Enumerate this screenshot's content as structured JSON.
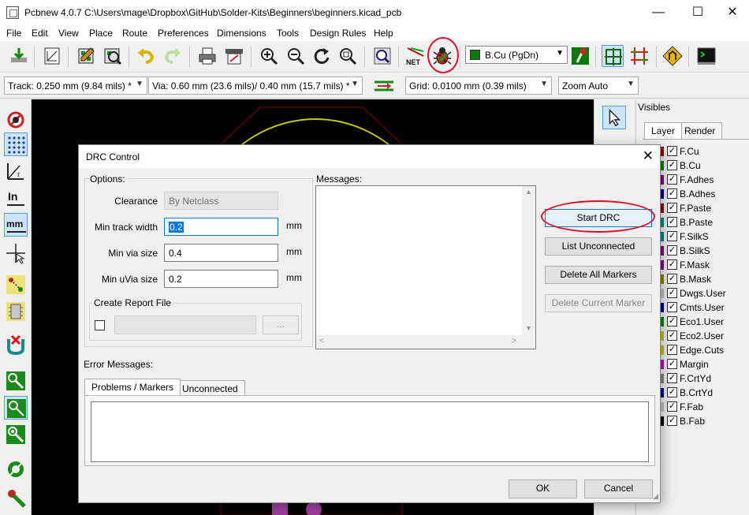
{
  "window": {
    "title": "Pcbnew 4.0.7 C:\\Users\\mage\\Dropbox\\GitHub\\Solder-Kits\\Beginners\\beginners.kicad_pcb",
    "min_glyph": "—",
    "max_glyph": "☐",
    "close_glyph": "✕"
  },
  "menu": [
    "File",
    "Edit",
    "View",
    "Place",
    "Route",
    "Preferences",
    "Dimensions",
    "Tools",
    "Design Rules",
    "Help"
  ],
  "layer_select": {
    "value": "B.Cu (PgDn)",
    "swatch_color": "#0b7a0b"
  },
  "toolbar2": {
    "track": "Track: 0.250 mm (9.84 mils) *",
    "via": "Via: 0.60 mm (23.6 mils)/ 0.40 mm (15.7 mils) *",
    "grid": "Grid: 0.0100 mm (0.39 mils)",
    "zoom": "Zoom Auto"
  },
  "layers_panel": {
    "title": "Visibles",
    "tabs": [
      "Layer",
      "Render"
    ],
    "layers": [
      {
        "name": "F.Cu",
        "color": "#840000",
        "checked": true
      },
      {
        "name": "B.Cu",
        "color": "#008400",
        "checked": true
      },
      {
        "name": "F.Adhes",
        "color": "#840084",
        "checked": true
      },
      {
        "name": "B.Adhes",
        "color": "#000084",
        "checked": true
      },
      {
        "name": "F.Paste",
        "color": "#840000",
        "checked": true
      },
      {
        "name": "B.Paste",
        "color": "#008484",
        "checked": true
      },
      {
        "name": "F.SilkS",
        "color": "#008484",
        "checked": true
      },
      {
        "name": "B.SilkS",
        "color": "#840084",
        "checked": true
      },
      {
        "name": "F.Mask",
        "color": "#840084",
        "checked": true
      },
      {
        "name": "B.Mask",
        "color": "#848400",
        "checked": true
      },
      {
        "name": "Dwgs.User",
        "color": "#c2c2c2",
        "checked": true
      },
      {
        "name": "Cmts.User",
        "color": "#000084",
        "checked": true
      },
      {
        "name": "Eco1.User",
        "color": "#008400",
        "checked": true
      },
      {
        "name": "Eco2.User",
        "color": "#c2c200",
        "checked": true
      },
      {
        "name": "Edge.Cuts",
        "color": "#c2c200",
        "checked": true
      },
      {
        "name": "Margin",
        "color": "#c200c2",
        "checked": true
      },
      {
        "name": "F.CrtYd",
        "color": "#848484",
        "checked": true
      },
      {
        "name": "B.CrtYd",
        "color": "#000084",
        "checked": true
      },
      {
        "name": "F.Fab",
        "color": "#c2c2c2",
        "checked": true
      },
      {
        "name": "B.Fab",
        "color": "#000000",
        "checked": true
      }
    ]
  },
  "dialog": {
    "title": "DRC Control",
    "close_glyph": "✕",
    "options_label": "Options:",
    "clearance_label": "Clearance",
    "clearance_value": "By Netclass",
    "min_track_label": "Min track width",
    "min_track_value": "0.2",
    "min_via_label": "Min via size",
    "min_via_value": "0.4",
    "min_uvia_label": "Min uVia size",
    "min_uvia_value": "0.2",
    "unit": "mm",
    "report_label": "Create Report File",
    "browse_label": "...",
    "messages_label": "Messages:",
    "buttons": {
      "start_drc": "Start DRC",
      "list_unconnected": "List Unconnected",
      "delete_all_markers": "Delete All Markers",
      "delete_current_marker": "Delete Current Marker"
    },
    "error_messages_label": "Error Messages:",
    "error_tabs": [
      "Problems / Markers",
      "Unconnected"
    ],
    "ok": "OK",
    "cancel": "Cancel"
  },
  "colors": {
    "annotation_red": "#e0102a",
    "accent_blue": "#0078d7",
    "board_outline": "#c8c800"
  }
}
